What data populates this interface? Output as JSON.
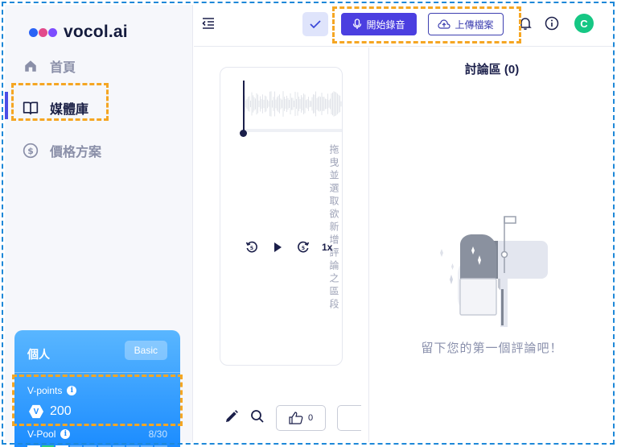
{
  "brand": {
    "name": "vocol.ai",
    "dot_colors": [
      "#2a63f5",
      "#e24a8b",
      "#7c4dff"
    ]
  },
  "sidebar": {
    "items": [
      {
        "label": "首頁",
        "icon": "home-icon",
        "active": false
      },
      {
        "label": "媒體庫",
        "icon": "book-icon",
        "active": true
      },
      {
        "label": "價格方案",
        "icon": "dollar-icon",
        "active": false
      }
    ]
  },
  "plan": {
    "title": "個人",
    "badge": "Basic",
    "vpoints_label": "V-points",
    "vpoints_value": "200",
    "vpool_label": "V-Pool",
    "vpool_count": "8/30",
    "vpool_fraction": 0.27
  },
  "topbar": {
    "record_label": "開始錄音",
    "upload_label": "上傳檔案",
    "avatar_initial": "C"
  },
  "player": {
    "hint": "拖曳並選取欲新增評論之區段",
    "speed": "1x"
  },
  "toolbar": {
    "like_count": "0"
  },
  "discussion": {
    "title": "討論區 (0)",
    "empty_text": "留下您的第一個評論吧！"
  },
  "colors": {
    "accent": "#4b3fe0",
    "card": "#1a8bff",
    "highlight": "#f5a623"
  }
}
